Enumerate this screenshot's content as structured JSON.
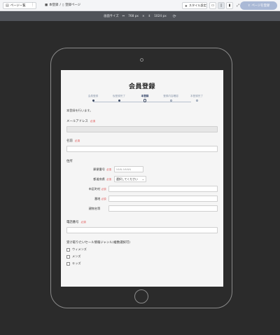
{
  "toolbar": {
    "page_list_label": "ページ一覧",
    "breadcrumb_folder": "本登録",
    "breadcrumb_sep": "/",
    "breadcrumb_page": "登録ページ",
    "style_label": "スタイル設定",
    "register_label": "ページを登録"
  },
  "sizebar": {
    "label": "画面サイズ",
    "width": "768 px",
    "times": "×",
    "height": "1024 px"
  },
  "form": {
    "title": "会員登録",
    "steps": [
      "会員登録",
      "仮登録完了",
      "本登録",
      "登録内容確認",
      "本登録完了"
    ],
    "current_step": 2,
    "intro": "本登録を行います。",
    "required_tag": "必須",
    "email_label": "メールアドレス",
    "name_label": "名前",
    "address_title": "住所",
    "address_fields": {
      "postal_label": "郵便番号",
      "postal_placeholder": "NNN-NNNN",
      "prefecture_label": "都道府県",
      "prefecture_value": "選択してください",
      "city_label": "市区町村",
      "street_label": "番地",
      "building_label": "建物名等"
    },
    "phone_label": "電話番号",
    "genre_label": "受け取りたいセール情報ジャンル(複数選択可)",
    "genres": [
      "ウィメンズ",
      "メンズ",
      "キッズ"
    ]
  }
}
